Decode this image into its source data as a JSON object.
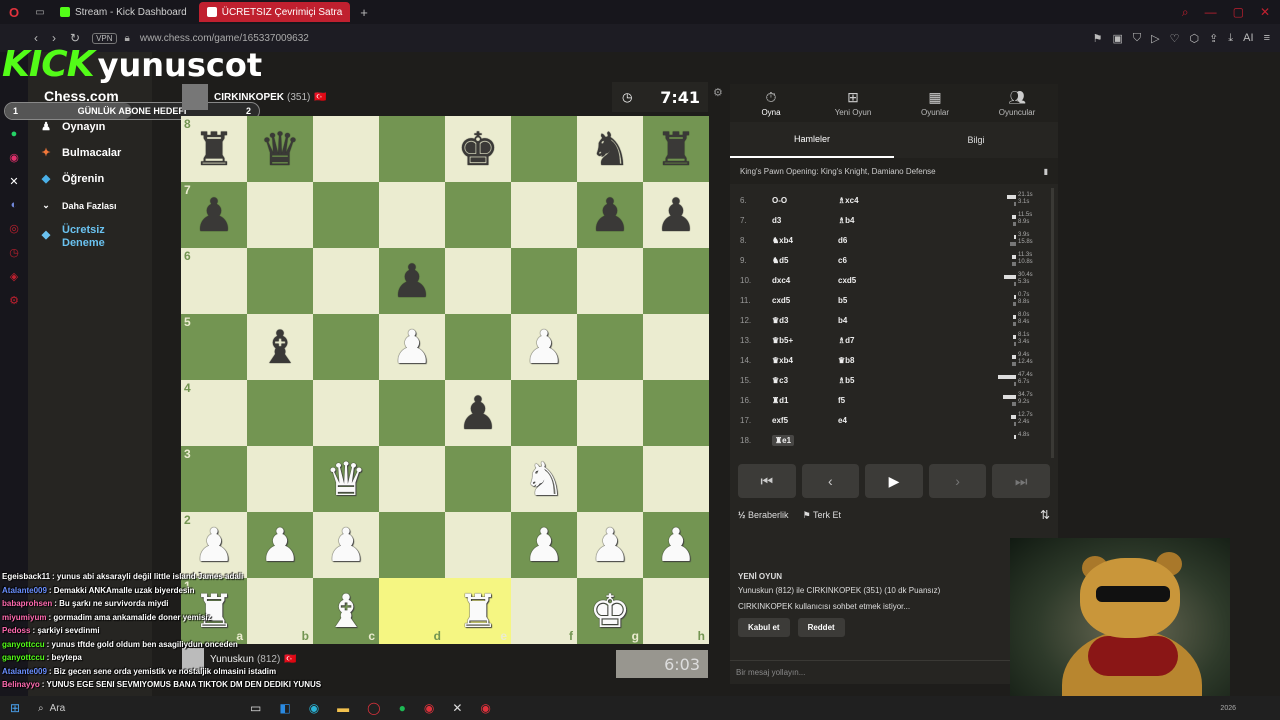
{
  "browser": {
    "tabs": [
      {
        "label": "Stream - Kick Dashboard",
        "active": false,
        "color": "#53fc18"
      },
      {
        "label": "ÜCRETSIZ Çevrimiçi Satra",
        "active": true,
        "color": "#ffffff"
      }
    ],
    "new_tab": "+",
    "vpn": "VPN",
    "url": "www.chess.com/game/165337009632"
  },
  "overlay": {
    "kick_logo": "KICK",
    "username": "yunuscot",
    "goal": {
      "left": "1",
      "label": "GÜNLÜK ABONE HEDEFİ",
      "right": "2",
      "progress": 0.5
    }
  },
  "sidebar": {
    "brand": "Chess.com",
    "items": [
      {
        "label": "Oynayın",
        "icon": "pawn-icon"
      },
      {
        "label": "Bulmacalar",
        "icon": "puzzle-icon"
      },
      {
        "label": "Öğrenin",
        "icon": "graduation-icon"
      },
      {
        "label": "Daha Fazlası",
        "icon": "chevron-down-icon"
      },
      {
        "label": "Ücretsiz Deneme",
        "icon": "diamond-icon"
      }
    ]
  },
  "top_player": {
    "name": "CIRKINKOPEK",
    "rating": "(351)",
    "flag": "🇹🇷",
    "clock": "7:41"
  },
  "bottom_player": {
    "name": "Yunuskun",
    "rating": "(812)",
    "flag": "🇹🇷",
    "clock": "6:03"
  },
  "board": {
    "ranks": [
      "8",
      "7",
      "6",
      "5",
      "4",
      "3",
      "2",
      "1"
    ],
    "files": [
      "a",
      "b",
      "c",
      "d",
      "e",
      "f",
      "g",
      "h"
    ],
    "position": [
      [
        "bR",
        "bQ",
        "",
        "",
        "bK",
        "",
        "bN",
        "bR"
      ],
      [
        "bP",
        "",
        "",
        "",
        "",
        "",
        "bP",
        "bP"
      ],
      [
        "",
        "",
        "",
        "bP",
        "",
        "",
        "",
        ""
      ],
      [
        "",
        "bB",
        "",
        "wP",
        "",
        "wP",
        "",
        ""
      ],
      [
        "",
        "",
        "",
        "",
        "bP",
        "",
        "",
        ""
      ],
      [
        "",
        "",
        "wQ",
        "",
        "",
        "wN",
        "",
        ""
      ],
      [
        "wP",
        "wP",
        "wP",
        "",
        "",
        "wP",
        "wP",
        "wP"
      ],
      [
        "wR",
        "",
        "wB",
        "",
        "wR",
        "",
        "wK",
        ""
      ]
    ],
    "highlight": [
      "d1",
      "e1"
    ]
  },
  "panel": {
    "top_tabs": [
      {
        "label": "Oyna",
        "icon": "stopwatch-icon",
        "active": true
      },
      {
        "label": "Yeni Oyun",
        "icon": "plus-icon",
        "active": false
      },
      {
        "label": "Oyunlar",
        "icon": "board-icon",
        "active": false
      },
      {
        "label": "Oyuncular",
        "icon": "players-icon",
        "active": false
      }
    ],
    "sub_tabs": [
      {
        "label": "Hamleler",
        "active": true
      },
      {
        "label": "Bilgi",
        "active": false
      }
    ],
    "opening": "King's Pawn Opening: King's Knight, Damiano Defense",
    "moves": [
      {
        "no": "6.",
        "w": "O-O",
        "b": "♗xc4",
        "tw": "21.1s",
        "tb": "3.1s",
        "fw": 0.3,
        "fb": 0.05
      },
      {
        "no": "7.",
        "w": "d3",
        "b": "♗b4",
        "tw": "11.5s",
        "tb": "8.9s",
        "fw": 0.15,
        "fb": 0.1
      },
      {
        "no": "8.",
        "w": "♞xb4",
        "b": "d6",
        "tw": "3.9s",
        "tb": "15.8s",
        "fw": 0.05,
        "fb": 0.2
      },
      {
        "no": "9.",
        "w": "♞d5",
        "b": "c6",
        "tw": "11.3s",
        "tb": "10.8s",
        "fw": 0.15,
        "fb": 0.15
      },
      {
        "no": "10.",
        "w": "dxc4",
        "b": "cxd5",
        "tw": "30.4s",
        "tb": "5.3s",
        "fw": 0.4,
        "fb": 0.07
      },
      {
        "no": "11.",
        "w": "cxd5",
        "b": "b5",
        "tw": "0.7s",
        "tb": "8.8s",
        "fw": 0.02,
        "fb": 0.1
      },
      {
        "no": "12.",
        "w": "♛d3",
        "b": "b4",
        "tw": "8.0s",
        "tb": "8.4s",
        "fw": 0.1,
        "fb": 0.1
      },
      {
        "no": "13.",
        "w": "♛b5+",
        "b": "♗d7",
        "tw": "8.1s",
        "tb": "3.4s",
        "fw": 0.1,
        "fb": 0.05
      },
      {
        "no": "14.",
        "w": "♛xb4",
        "b": "♛b8",
        "tw": "9.4s",
        "tb": "12.4s",
        "fw": 0.12,
        "fb": 0.15
      },
      {
        "no": "15.",
        "w": "♛c3",
        "b": "♗b5",
        "tw": "47.4s",
        "tb": "6.7s",
        "fw": 0.6,
        "fb": 0.08
      },
      {
        "no": "16.",
        "w": "♜d1",
        "b": "f5",
        "tw": "34.7s",
        "tb": "9.2s",
        "fw": 0.45,
        "fb": 0.12
      },
      {
        "no": "17.",
        "w": "exf5",
        "b": "e4",
        "tw": "12.7s",
        "tb": "2.4s",
        "fw": 0.16,
        "fb": 0.03
      },
      {
        "no": "18.",
        "w": "♜e1",
        "b": "",
        "tw": "4.8s",
        "tb": "",
        "fw": 0.06,
        "fb": 0
      }
    ],
    "controls": [
      "⏮",
      "‹",
      "▶",
      "›",
      "⏭"
    ],
    "draw_label": "Beraberlik",
    "resign_label": "Terk Et",
    "draw_icon": "½",
    "new_game": {
      "heading": "YENİ OYUN",
      "line1": "Yunuskun (812) ile CIRKINKOPEK (351) (10 dk Puansız)",
      "line2": "CIRKINKOPEK kullanıcısı sohbet etmek istiyor...",
      "accept": "Kabul et",
      "reject": "Reddet"
    },
    "message_placeholder": "Bir mesaj yollayın..."
  },
  "chat": [
    {
      "user": "Egeisback11",
      "text": ": yunus abi aksarayli değil little island James adali",
      "color": "#ffffff"
    },
    {
      "user": "Atalante009",
      "text": ": Demakki ANKAmalle uzak biyerdesin",
      "color": "#6a8fff"
    },
    {
      "user": "babaprohsen",
      "text": ": Bu şarkı ne survivorda miydi",
      "color": "#ff6ab0"
    },
    {
      "user": "miyumiyum",
      "text": ": gormadim ama ankamalide doner yemisiz",
      "color": "#ff6ab0"
    },
    {
      "user": "Pedoss",
      "text": ": şarkiyi sevdinmi",
      "color": "#ff6ab0"
    },
    {
      "user": "ganyottccu",
      "text": ": yunus tftde gold oldum ben asagiliydun onceden",
      "color": "#53fc18"
    },
    {
      "user": "ganyottccu",
      "text": ": beytepa",
      "color": "#53fc18"
    },
    {
      "user": "Atalante009",
      "text": ": Biz gecen sene orda yemistik ve nostaljik olmasini istadim",
      "color": "#6a8fff"
    },
    {
      "user": "Belinayyo",
      "text": ": YUNUS EGE SENI SEVMIYOMUS BANA TIKTOK DM DEN DEDIKI YUNUS",
      "color": "#ff6ab0"
    }
  ],
  "taskbar": {
    "search": "Ara",
    "year": "2026"
  }
}
